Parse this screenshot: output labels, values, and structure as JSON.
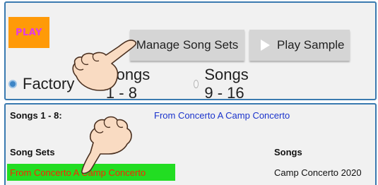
{
  "top_panel": {
    "play_label": "PLAY",
    "manage_label": "Manage Song Sets",
    "sample_label": "Play Sample",
    "radios": [
      {
        "label": "Factory",
        "selected": true
      },
      {
        "label": "Songs 1 - 8",
        "selected": false
      },
      {
        "label": "Songs 9 - 16",
        "selected": false
      }
    ]
  },
  "bottom_panel": {
    "songs_title": "Songs 1 - 8:",
    "song_set_name": "From Concerto A Camp Concerto",
    "col_song_sets": "Song Sets",
    "col_songs": "Songs",
    "selected_set": "From Concerto A Camp Concerto",
    "songs": [
      "Camp Concerto 2020"
    ]
  },
  "colors": {
    "panel_border": "#3a7ab0",
    "play_bg": "#ff9a08",
    "play_text": "#e23be6",
    "selected_bg": "#22dd22",
    "selected_text": "#ff2200",
    "link_blue": "#1a33cc"
  },
  "icons": [
    "play-triangle-icon",
    "pointing-hand-icon"
  ]
}
